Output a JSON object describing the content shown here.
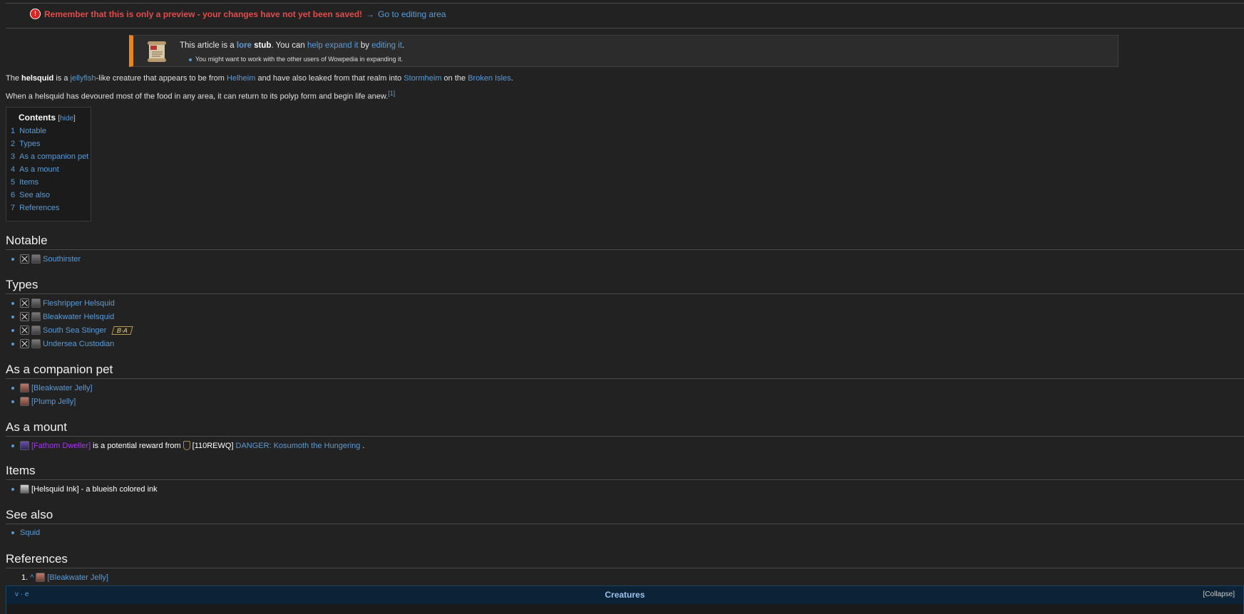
{
  "preview": {
    "warning": "Remember that this is only a preview - your changes have not yet been saved!",
    "arrow": "→",
    "link": "Go to editing area"
  },
  "stub": {
    "text_pre": "This article is a",
    "lore": "lore",
    "stub_word": "stub",
    "text_mid": ". You can",
    "help_expand": "help expand it",
    "by": "by",
    "editing": "editing it",
    "period": ".",
    "sub": "You might want to work with the other users of Wowpedia in expanding it."
  },
  "intro": {
    "p1": {
      "the": "The",
      "name": "helsquid",
      "is_a": "is a",
      "jellyfish": "jellyfish",
      "like": "-like creature that appears to be from",
      "helheim": "Helheim",
      "leaked": "and have also leaked from that realm into",
      "stormheim": "Stormheim",
      "on_the": "on the",
      "broken_isles": "Broken Isles",
      "end": "."
    },
    "p2": {
      "text": "When a helsquid has devoured most of the food in any area, it can return to its polyp form and begin life anew.",
      "ref": "[1]"
    }
  },
  "toc": {
    "title": "Contents",
    "hide_open": "[",
    "hide": "hide",
    "hide_close": "]",
    "entries": [
      {
        "num": "1",
        "label": "Notable"
      },
      {
        "num": "2",
        "label": "Types"
      },
      {
        "num": "3",
        "label": "As a companion pet"
      },
      {
        "num": "4",
        "label": "As a mount"
      },
      {
        "num": "5",
        "label": "Items"
      },
      {
        "num": "6",
        "label": "See also"
      },
      {
        "num": "7",
        "label": "References"
      }
    ]
  },
  "sections": {
    "notable": {
      "heading": "Notable",
      "items": [
        "Southirster"
      ]
    },
    "types": {
      "heading": "Types",
      "items": [
        "Fleshripper Helsquid",
        "Bleakwater Helsquid",
        "South Sea Stinger",
        "Undersea Custodian"
      ],
      "badge": "B·A"
    },
    "pet": {
      "heading": "As a companion pet",
      "items": [
        "[Bleakwater Jelly]",
        "[Plump Jelly]"
      ]
    },
    "mount": {
      "heading": "As a mount",
      "item_link": "[Fathom Dweller]",
      "mid": "is a potential reward from",
      "quest_level": "[110REWQ]",
      "quest": "DANGER: Kosumoth the Hungering",
      "end": "."
    },
    "items": {
      "heading": "Items",
      "item": "[Helsquid Ink]",
      "desc": "- a blueish colored ink"
    },
    "see_also": {
      "heading": "See also",
      "items": [
        "Squid"
      ]
    },
    "references": {
      "heading": "References",
      "num": "1.",
      "caret": "^",
      "item": "[Bleakwater Jelly]"
    }
  },
  "navbox": {
    "vte": "v · e",
    "title": "Creatures",
    "collapse": "[Collapse]"
  },
  "colors": {
    "background": "#222222",
    "link": "#5b9bd5",
    "warning": "#e14b4b",
    "stub_accent": "#e8861a",
    "epic": "#a335ee",
    "navbox": "#0c2236"
  }
}
